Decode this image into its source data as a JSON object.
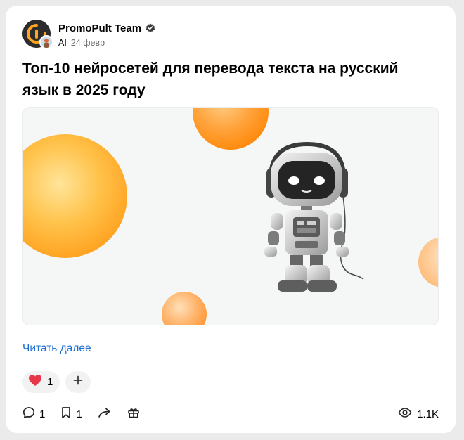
{
  "post": {
    "author": {
      "name": "PromoPult Team",
      "verified_icon": "verified-check-icon",
      "avatar_icon": "promopult-logo-icon",
      "channel_label": "AI",
      "date": "24 февр"
    },
    "title": "Топ-10 нейросетей для перевода текста на русский язык в 2025 году",
    "cover_image": "robot-with-headphones-illustration",
    "read_more_label": "Читать далее",
    "reactions": [
      {
        "icon": "heart-icon",
        "count": "1"
      }
    ],
    "add_reaction_icon": "plus-icon",
    "footer": {
      "comments": {
        "icon": "comment-icon",
        "count": "1"
      },
      "bookmarks": {
        "icon": "bookmark-icon",
        "count": "1"
      },
      "share_icon": "share-arrow-icon",
      "gift_icon": "gift-icon",
      "views": {
        "icon": "eye-icon",
        "count": "1.1K"
      }
    }
  },
  "colors": {
    "link": "#1f6fd1",
    "heart": "#e8374a",
    "accent_orange": "#ffa423",
    "card_background": "#ffffff",
    "page_background": "#ebebeb"
  }
}
